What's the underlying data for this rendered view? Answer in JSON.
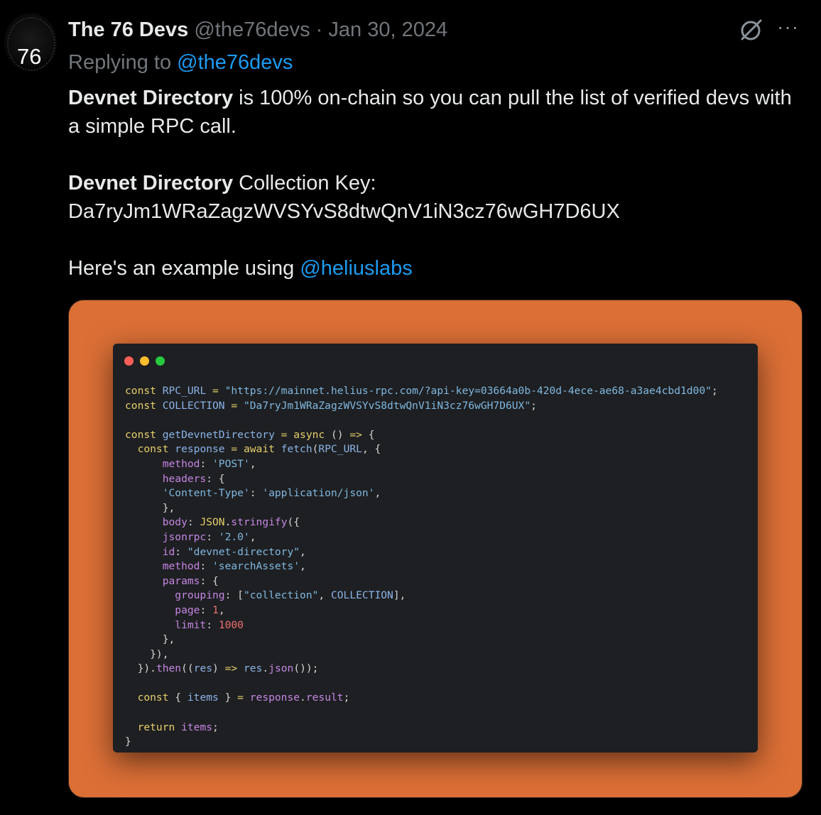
{
  "tweet": {
    "avatar_text": "76",
    "display_name": "The 76 Devs",
    "handle": "@the76devs",
    "separator": "·",
    "date": "Jan 30, 2024",
    "replying_to_label": "Replying to",
    "replying_to_handle": "@the76devs",
    "more_label": "···",
    "para1_bold": "Devnet Directory",
    "para1_rest": " is 100% on-chain so you can pull the list of verified devs with a simple RPC call.",
    "para2_bold": "Devnet Directory",
    "para2_rest": " Collection Key:",
    "collection_key": "Da7ryJm1WRaZagzWVSYvS8dtwQnV1iN3cz76wGH7D6UX",
    "para3_text": "Here's an example using ",
    "para3_mention": "@heliuslabs"
  },
  "colors": {
    "background": "#000000",
    "link": "#1d9bf0",
    "muted": "#71767b",
    "media_bg": "#db6f36",
    "editor_bg": "#1e1f22",
    "dot_red": "#ff5f56",
    "dot_yellow": "#ffbd2e",
    "dot_green": "#27c93f"
  },
  "code": {
    "l1": [
      "const",
      " RPC_URL ",
      "=",
      " \"https://mainnet.helius-rpc.com/?api-key=03664a0b-420d-4ece-ae68-a3ae4cbd1d00\"",
      ";"
    ],
    "l2": [
      "const",
      " COLLECTION ",
      "=",
      " \"Da7ryJm1WRaZagzWVSYvS8dtwQnV1iN3cz76wGH7D6UX\"",
      ";"
    ],
    "l3": [
      "const",
      " getDevnetDirectory ",
      "=",
      " async",
      " () ",
      "=>",
      " {"
    ],
    "l4": [
      "  const",
      " response ",
      "=",
      " await",
      " fetch",
      "(",
      "RPC_URL",
      ", {"
    ],
    "l5": [
      "      method",
      ": ",
      "'POST'",
      ","
    ],
    "l6": [
      "      headers",
      ": {"
    ],
    "l7": [
      "      'Content-Type'",
      ": ",
      "'application/json'",
      ","
    ],
    "l8": [
      "      },"
    ],
    "l9": [
      "      body",
      ": ",
      "JSON",
      ".",
      "stringify",
      "({"
    ],
    "l10": [
      "      jsonrpc",
      ": ",
      "'2.0'",
      ","
    ],
    "l11": [
      "      id",
      ": ",
      "\"devnet-directory\"",
      ","
    ],
    "l12": [
      "      method",
      ": ",
      "'searchAssets'",
      ","
    ],
    "l13": [
      "      params",
      ": {"
    ],
    "l14": [
      "        grouping",
      ": [",
      "\"collection\"",
      ", ",
      "COLLECTION",
      "],"
    ],
    "l15": [
      "        page",
      ": ",
      "1",
      ","
    ],
    "l16": [
      "        limit",
      ": ",
      "1000"
    ],
    "l17": [
      "      },"
    ],
    "l18": [
      "    }),"
    ],
    "l19": [
      "  })",
      ".",
      "then",
      "((",
      "res",
      ") ",
      "=>",
      " res",
      ".",
      "json",
      "());"
    ],
    "l20": [
      "  const",
      " { ",
      "items",
      " } ",
      "=",
      " response",
      ".",
      "result",
      ";"
    ],
    "l21": [
      "  return",
      " items",
      ";"
    ],
    "l22": [
      "}"
    ]
  }
}
